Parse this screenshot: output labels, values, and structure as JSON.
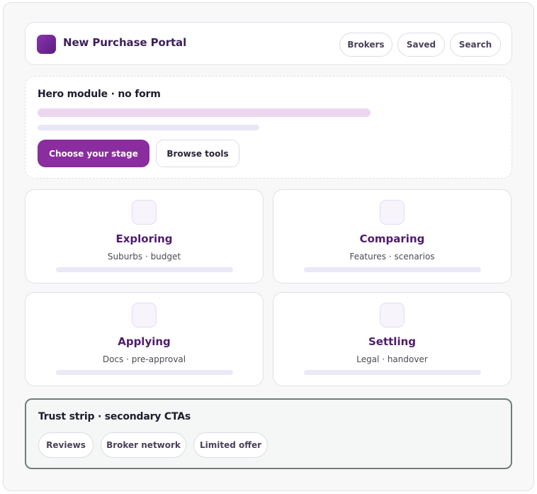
{
  "header": {
    "brand": "New Purchase Portal",
    "nav": [
      "Brokers",
      "Saved",
      "Search"
    ]
  },
  "hero": {
    "title": "Hero module · no form",
    "primary_cta": "Choose your stage",
    "secondary_cta": "Browse tools"
  },
  "stages": [
    {
      "title": "Exploring",
      "subtitle": "Suburbs · budget"
    },
    {
      "title": "Comparing",
      "subtitle": "Features · scenarios"
    },
    {
      "title": "Applying",
      "subtitle": "Docs · pre-approval"
    },
    {
      "title": "Settling",
      "subtitle": "Legal · handover"
    }
  ],
  "trust": {
    "title": "Trust strip · secondary CTAs",
    "chips": [
      "Reviews",
      "Broker network",
      "Limited offer"
    ]
  },
  "colors": {
    "brand_purple": "#8a2d9e",
    "title_purple": "#4e1c6b",
    "trust_border": "#6f7f78"
  }
}
